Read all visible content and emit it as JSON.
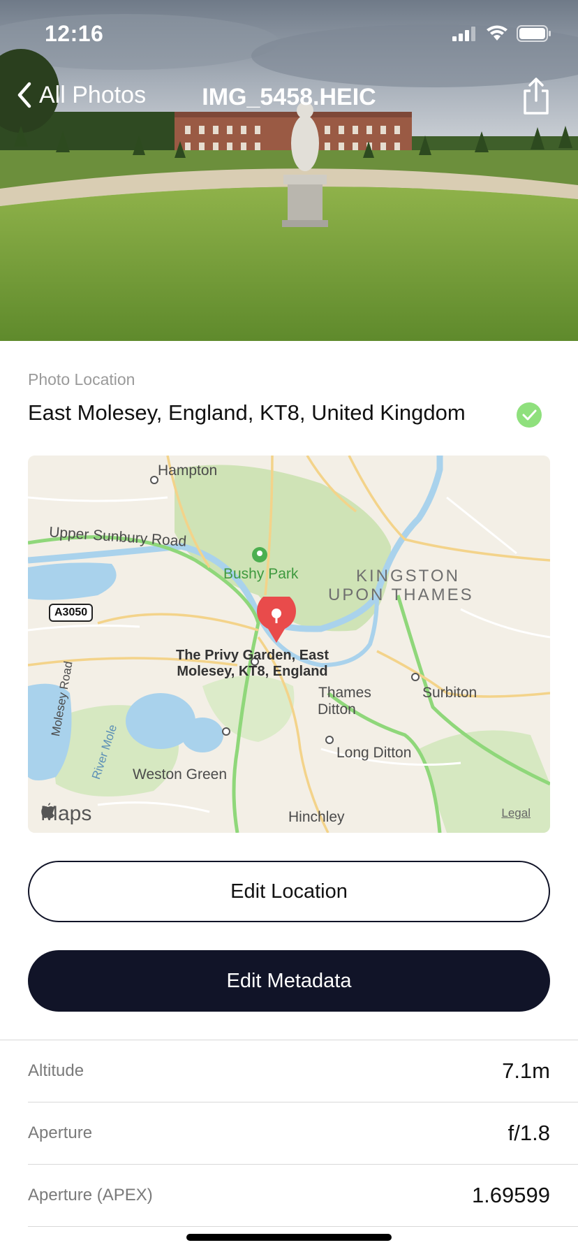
{
  "status_bar": {
    "time": "12:16",
    "icons": [
      "signal-icon",
      "wifi-icon",
      "battery-icon"
    ]
  },
  "navbar": {
    "back_label": "All Photos",
    "title": "IMG_5458.HEIC",
    "share_icon": "share-icon"
  },
  "location": {
    "caption": "Photo Location",
    "address": "East Molesey, England, KT8, United Kingdom",
    "verified_icon": "check-icon",
    "verified_color": "#8fe07d"
  },
  "map": {
    "labels": {
      "hampton": "Hampton",
      "upper_sunbury_road": "Upper Sunbury Road",
      "bushy_park": "Bushy Park",
      "kingston_line1": "KINGSTON",
      "kingston_line2": "UPON THAMES",
      "road_badge": "A3050",
      "pin_label_line1": "The Privy Garden, East",
      "pin_label_line2": "Molesey, KT8, England",
      "thames_line1": "Thames",
      "thames_line2": "Ditton",
      "surbiton": "Surbiton",
      "weston_green": "Weston Green",
      "long_ditton": "Long Ditton",
      "hinchley": "Hinchley",
      "molesey_road": "Molesey Road",
      "river_mole": "River Mole"
    },
    "watermark": "Maps",
    "legal": "Legal",
    "pin_color": "#e94b4b"
  },
  "actions": {
    "edit_location": "Edit Location",
    "edit_metadata": "Edit Metadata"
  },
  "metadata": [
    {
      "label": "Altitude",
      "value": "7.1m"
    },
    {
      "label": "Aperture",
      "value": "f/1.8"
    },
    {
      "label": "Aperture (APEX)",
      "value": "1.69599"
    }
  ],
  "colors": {
    "primary_dark": "#111428",
    "background": "#ffffff"
  }
}
